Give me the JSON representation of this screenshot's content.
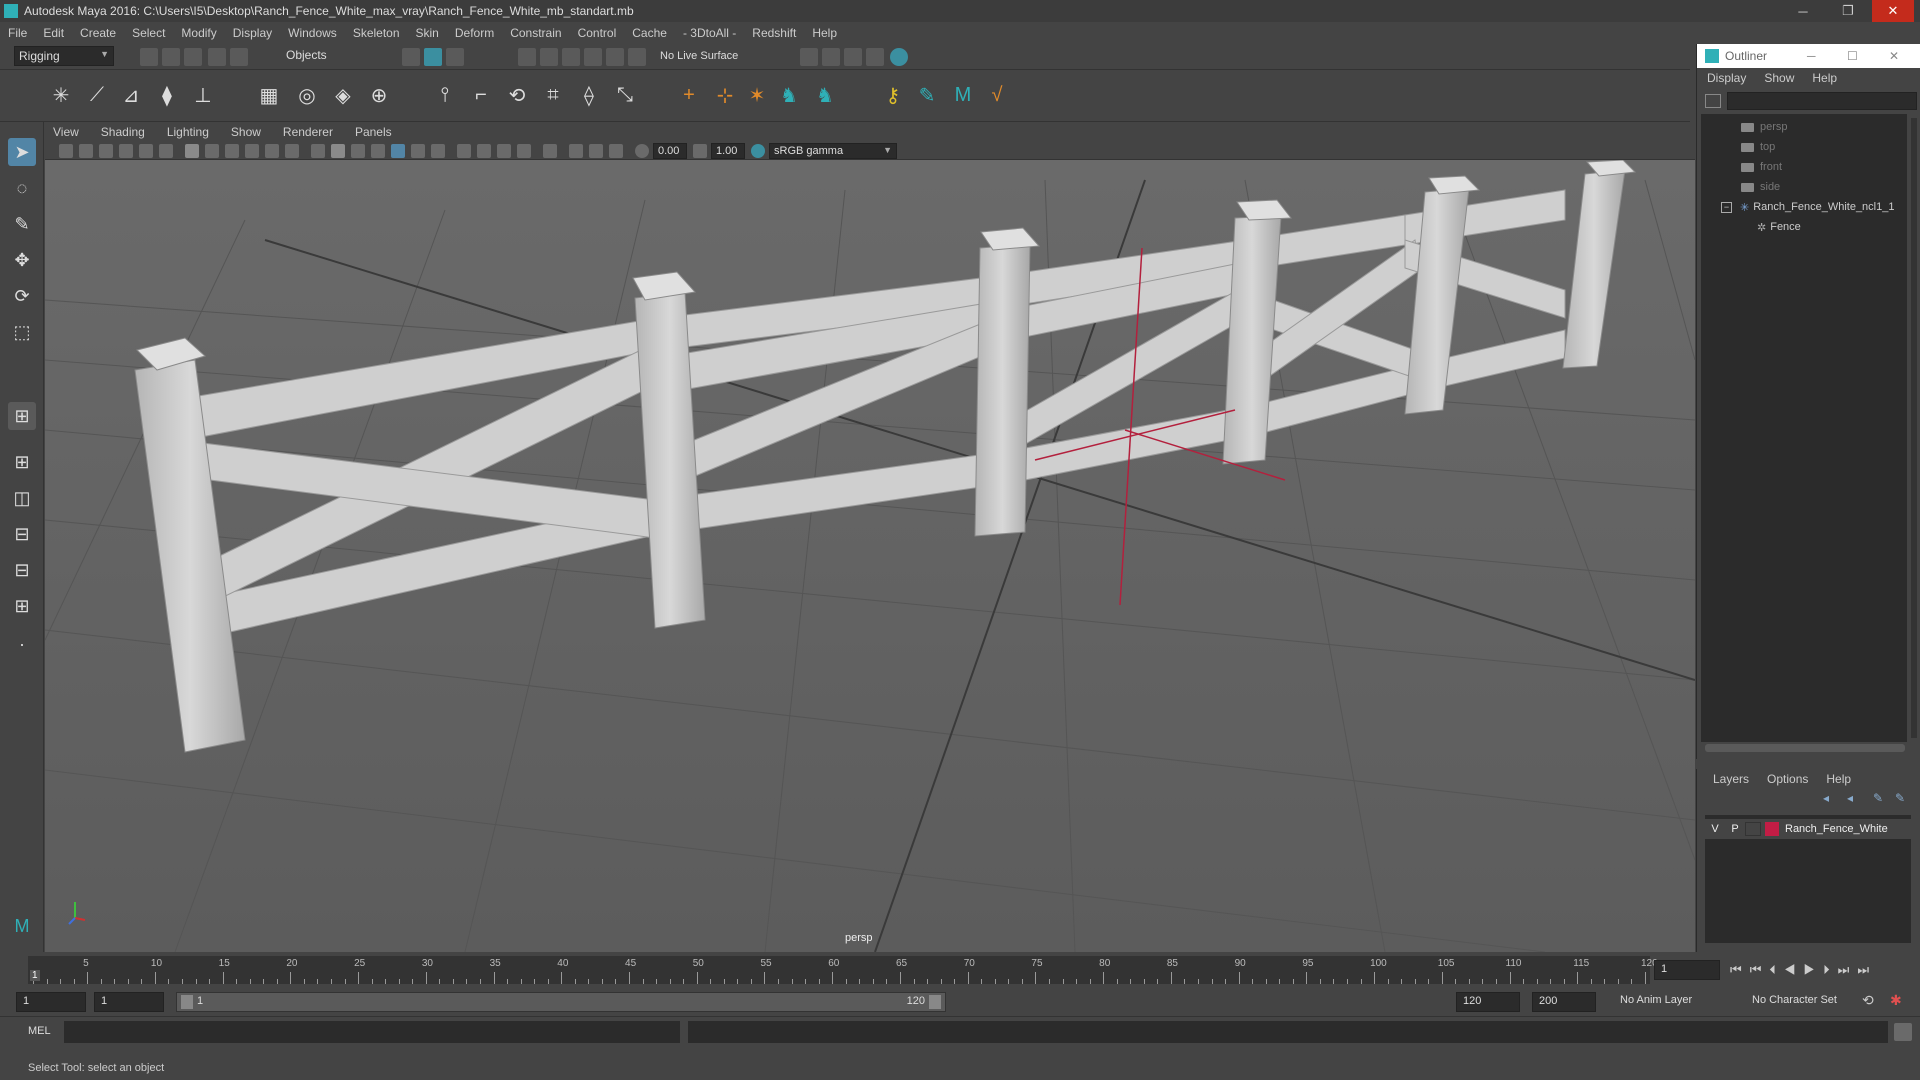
{
  "window": {
    "title": "Autodesk Maya 2016: C:\\Users\\I5\\Desktop\\Ranch_Fence_White_max_vray\\Ranch_Fence_White_mb_standart.mb",
    "min": "─",
    "restore": "❐",
    "close": "✕"
  },
  "menubar": [
    "File",
    "Edit",
    "Create",
    "Select",
    "Modify",
    "Display",
    "Windows",
    "Skeleton",
    "Skin",
    "Deform",
    "Constrain",
    "Control",
    "Cache",
    "- 3DtoAll -",
    "Redshift",
    "Help"
  ],
  "statusline": {
    "mode": "Rigging",
    "selection_mode": "Objects",
    "live_surface": "No Live Surface"
  },
  "panel": {
    "menu": [
      "View",
      "Shading",
      "Lighting",
      "Show",
      "Renderer",
      "Panels"
    ],
    "field_a": "0.00",
    "field_b": "1.00",
    "color_space": "sRGB gamma",
    "camera_label": "persp"
  },
  "outliner": {
    "title": "Outliner",
    "menu": [
      "Display",
      "Show",
      "Help"
    ],
    "items": [
      {
        "label": "persp",
        "dim": true
      },
      {
        "label": "top",
        "dim": true
      },
      {
        "label": "front",
        "dim": true
      },
      {
        "label": "side",
        "dim": true
      },
      {
        "label": "Ranch_Fence_White_ncl1_1",
        "dim": false
      },
      {
        "label": "Fence",
        "dim": false
      }
    ]
  },
  "layers": {
    "menu": [
      "Layers",
      "Options",
      "Help"
    ],
    "row": {
      "v": "V",
      "p": "P",
      "name": "Ranch_Fence_White",
      "color": "#c21d45"
    }
  },
  "timeline": {
    "ticks": [
      "5",
      "10",
      "15",
      "20",
      "25",
      "30",
      "35",
      "40",
      "45",
      "50",
      "55",
      "60",
      "65",
      "70",
      "75",
      "80",
      "85",
      "90",
      "95",
      "100",
      "105",
      "110",
      "115",
      "120"
    ],
    "current_frame": "1",
    "start_marker": "1"
  },
  "range": {
    "start": "1",
    "playback_start": "1",
    "slider_start": "1",
    "slider_end": "120",
    "playback_end": "120",
    "end": "200",
    "anim_layer": "No Anim Layer",
    "character_set": "No Character Set"
  },
  "cmd": {
    "lang": "MEL",
    "help": "Select Tool: select an object"
  },
  "colors": {
    "accent": "#5285a6",
    "viewport_bg": "#666666",
    "manip_red": "#b3203d"
  }
}
